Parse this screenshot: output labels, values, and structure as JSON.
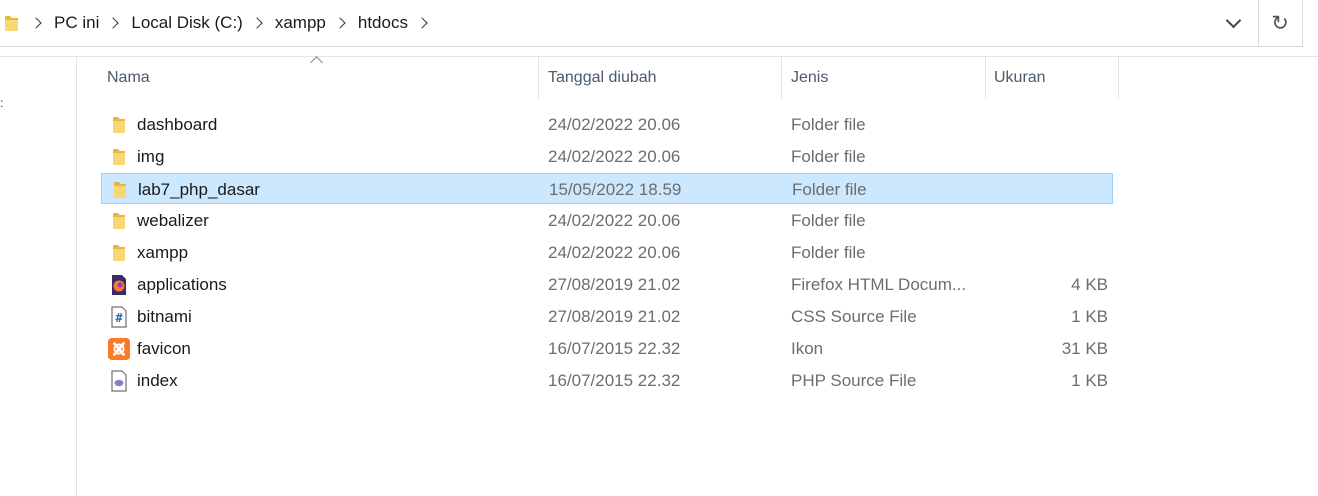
{
  "address": {
    "crumbs": [
      "PC ini",
      "Local Disk (C:)",
      "xampp",
      "htdocs"
    ]
  },
  "columns": {
    "name": "Nama",
    "date": "Tanggal diubah",
    "type": "Jenis",
    "size": "Ukuran"
  },
  "files": [
    {
      "name": "dashboard",
      "date": "24/02/2022 20.06",
      "type": "Folder file",
      "size": "",
      "icon": "folder-icon"
    },
    {
      "name": "img",
      "date": "24/02/2022 20.06",
      "type": "Folder file",
      "size": "",
      "icon": "folder-icon"
    },
    {
      "name": "lab7_php_dasar",
      "date": "15/05/2022 18.59",
      "type": "Folder file",
      "size": "",
      "icon": "folder-icon",
      "selected": true
    },
    {
      "name": "webalizer",
      "date": "24/02/2022 20.06",
      "type": "Folder file",
      "size": "",
      "icon": "folder-icon"
    },
    {
      "name": "xampp",
      "date": "24/02/2022 20.06",
      "type": "Folder file",
      "size": "",
      "icon": "folder-icon"
    },
    {
      "name": "applications",
      "date": "27/08/2019 21.02",
      "type": "Firefox HTML Docum...",
      "size": "4 KB",
      "icon": "firefox-html-icon"
    },
    {
      "name": "bitnami",
      "date": "27/08/2019 21.02",
      "type": "CSS Source File",
      "size": "1 KB",
      "icon": "css-file-icon"
    },
    {
      "name": "favicon",
      "date": "16/07/2015 22.32",
      "type": "Ikon",
      "size": "31 KB",
      "icon": "xampp-ico-icon"
    },
    {
      "name": "index",
      "date": "16/07/2015 22.32",
      "type": "PHP Source File",
      "size": "1 KB",
      "icon": "php-file-icon"
    }
  ],
  "colors": {
    "selection": "#cce8ff",
    "selection_border": "#99d1ff",
    "folder": "#f8d775",
    "xampp": "#fb7a24"
  }
}
